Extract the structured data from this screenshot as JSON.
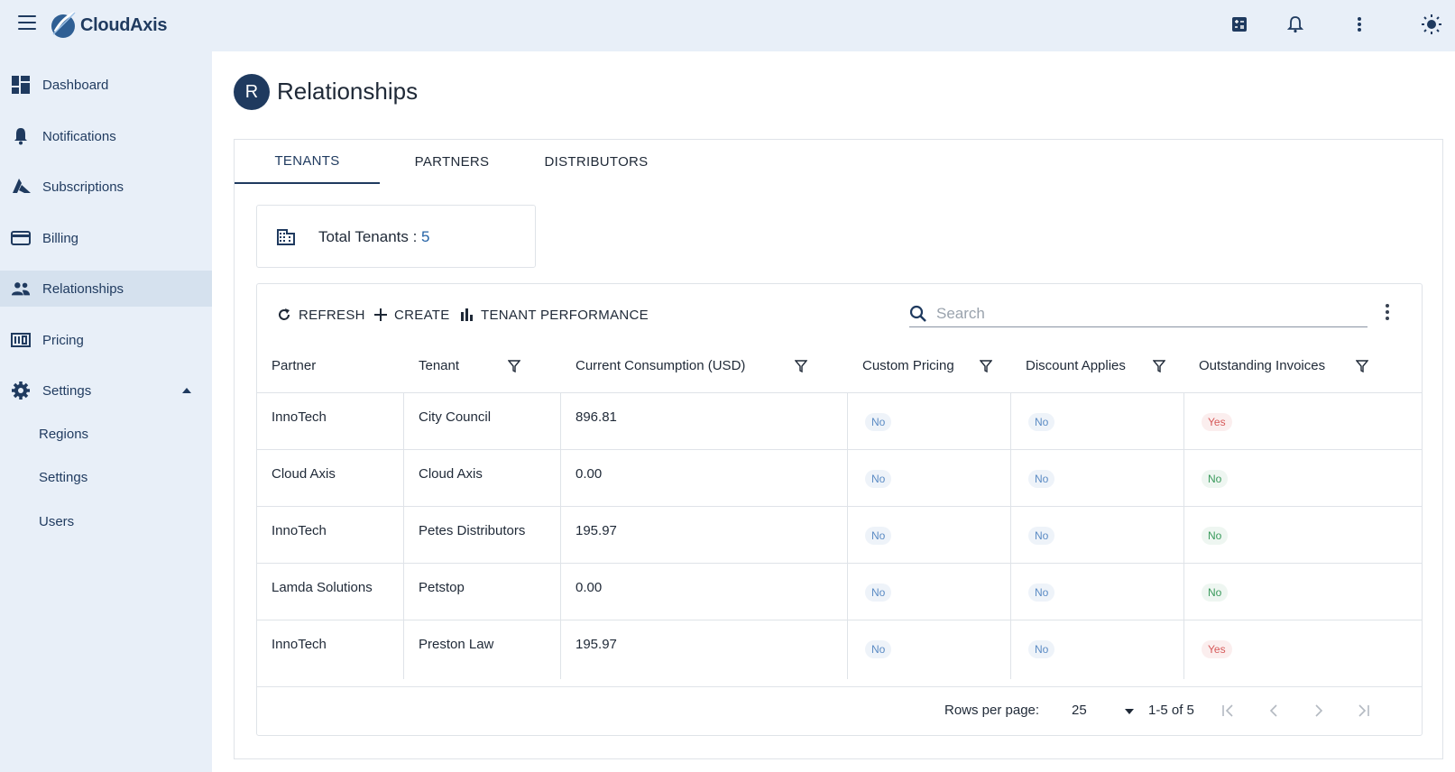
{
  "app": {
    "name": "CloudAxis"
  },
  "sidebar": {
    "items": [
      {
        "label": "Dashboard",
        "icon": "dashboard-icon"
      },
      {
        "label": "Notifications",
        "icon": "bell-icon"
      },
      {
        "label": "Subscriptions",
        "icon": "azure-icon"
      },
      {
        "label": "Billing",
        "icon": "credit-card-icon"
      },
      {
        "label": "Relationships",
        "icon": "people-icon",
        "active": true
      },
      {
        "label": "Pricing",
        "icon": "pricing-icon"
      },
      {
        "label": "Settings",
        "icon": "gear-icon",
        "expanded": true
      }
    ],
    "sub_items": [
      {
        "label": "Regions"
      },
      {
        "label": "Settings"
      },
      {
        "label": "Users"
      }
    ]
  },
  "page": {
    "avatar_letter": "R",
    "title": "Relationships"
  },
  "tabs": [
    {
      "label": "TENANTS",
      "active": true
    },
    {
      "label": "PARTNERS"
    },
    {
      "label": "DISTRIBUTORS"
    }
  ],
  "stat": {
    "label": "Total Tenants : ",
    "value": "5"
  },
  "toolbar": {
    "refresh_label": "REFRESH",
    "create_label": "CREATE",
    "performance_label": "TENANT PERFORMANCE",
    "search_placeholder": "Search"
  },
  "table": {
    "headers": [
      "Partner",
      "Tenant",
      "Current Consumption (USD)",
      "Custom Pricing",
      "Discount Applies",
      "Outstanding Invoices"
    ],
    "rows": [
      {
        "partner": "InnoTech",
        "tenant": "City Council",
        "consumption": "896.81",
        "custom_pricing": "No",
        "discount": "No",
        "outstanding": "Yes"
      },
      {
        "partner": "Cloud Axis",
        "tenant": "Cloud Axis",
        "consumption": "0.00",
        "custom_pricing": "No",
        "discount": "No",
        "outstanding": "No"
      },
      {
        "partner": "InnoTech",
        "tenant": "Petes Distributors",
        "consumption": "195.97",
        "custom_pricing": "No",
        "discount": "No",
        "outstanding": "No"
      },
      {
        "partner": "Lamda Solutions",
        "tenant": "Petstop",
        "consumption": "0.00",
        "custom_pricing": "No",
        "discount": "No",
        "outstanding": "No"
      },
      {
        "partner": "InnoTech",
        "tenant": "Preston Law",
        "consumption": "195.97",
        "custom_pricing": "No",
        "discount": "No",
        "outstanding": "Yes"
      }
    ]
  },
  "pagination": {
    "rows_label": "Rows per page:",
    "rows_value": "25",
    "range": "1-5 of 5"
  },
  "colors": {
    "brand": "#1f3a5f",
    "sidebar_bg": "#e8eff8",
    "yes": "#d65a5a",
    "no_blue": "#5b8bc4",
    "no_green": "#3a9a5c"
  }
}
